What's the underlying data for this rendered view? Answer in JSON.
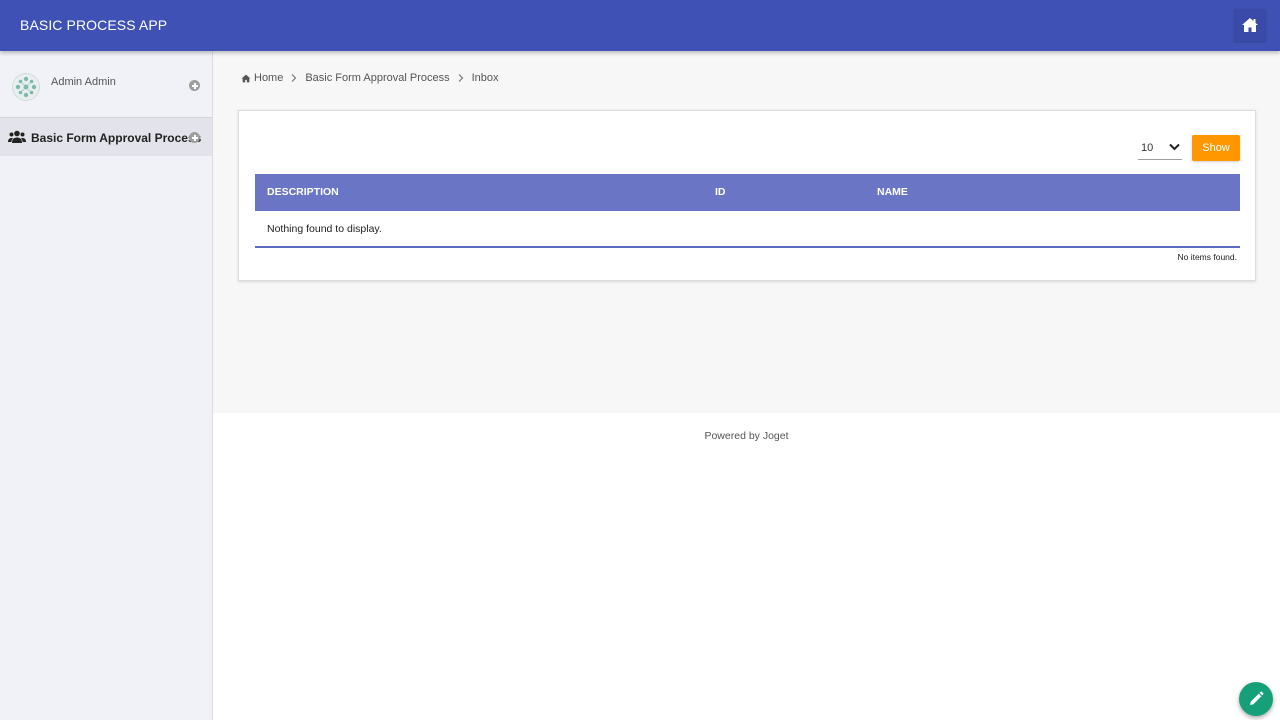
{
  "header": {
    "app_title": "BASIC PROCESS APP",
    "home_icon": "home-icon",
    "color": "#3f51b5"
  },
  "sidebar": {
    "user": {
      "name": "Admin Admin",
      "avatar_icon": "avatar-icon",
      "toggle_icon": "plus-circle-icon"
    },
    "menu": [
      {
        "label": "Basic Form Approval Process",
        "icon": "users-icon",
        "toggle_icon": "plus-circle-icon"
      }
    ]
  },
  "breadcrumb": {
    "home_icon": "home-icon",
    "items": [
      "Home",
      "Basic Form Approval Process",
      "Inbox"
    ]
  },
  "list": {
    "page_size": "10",
    "show_label": "Show",
    "columns": [
      "DESCRIPTION",
      "ID",
      "NAME"
    ],
    "empty_message": "Nothing found to display.",
    "footer_message": "No items found.",
    "header_color": "#6a75c6",
    "button_color": "#ff9800"
  },
  "footer": {
    "powered_by": "Powered by Joget"
  },
  "fab": {
    "icon": "pencil-icon",
    "color": "#15a07a"
  }
}
